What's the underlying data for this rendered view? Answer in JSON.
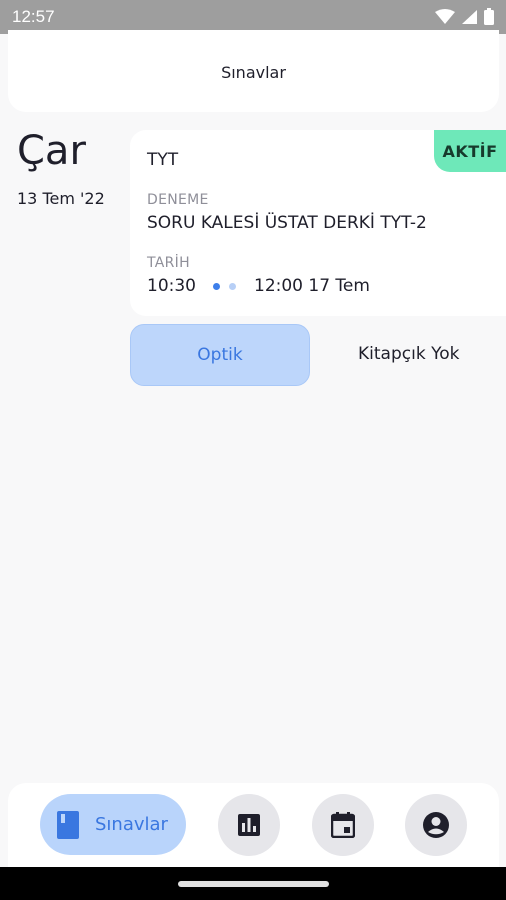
{
  "status_bar": {
    "time": "12:57"
  },
  "header": {
    "title": "Sınavlar"
  },
  "day": {
    "name": "Çar",
    "date": "13 Tem '22"
  },
  "exam": {
    "type": "TYT",
    "status": "AKTİF",
    "deneme_label": "DENEME",
    "deneme_value": "SORU KALESİ ÜSTAT DERKİ TYT-2",
    "tarih_label": "TARİH",
    "start_time": "10:30",
    "end_time": "12:00 17 Tem"
  },
  "actions": {
    "optik_label": "Optik",
    "booklet_text": "Kitapçık Yok"
  },
  "bottom_nav": {
    "items": [
      {
        "label": "Sınavlar",
        "icon": "book-icon",
        "active": true
      },
      {
        "icon": "bar-chart-icon"
      },
      {
        "icon": "calendar-icon"
      },
      {
        "icon": "account-icon"
      }
    ]
  },
  "colors": {
    "accent": "#3a77e0",
    "accent_light": "#bdd6fb",
    "status_green": "#6ee8b9",
    "background": "#f8f8f9"
  }
}
